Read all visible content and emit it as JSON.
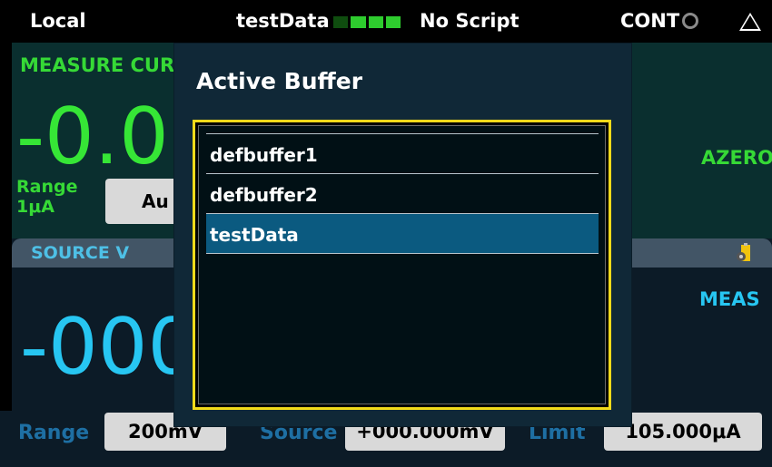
{
  "status_bar": {
    "mode": "Local",
    "buffer_name": "testData",
    "script": "No Script",
    "trigger": "CONT"
  },
  "measure": {
    "title": "MEASURE CUR",
    "value": "-0.0",
    "azero": "AZERO",
    "range_label": "Range",
    "range_value": "1μA",
    "range_button": "Au"
  },
  "source": {
    "title": "SOURCE V",
    "value": "-000",
    "meas_label": "MEAS"
  },
  "bottom_bar": {
    "range_label": "Range",
    "range_value": "200mV",
    "source_label": "Source",
    "source_value": "+000.000mV",
    "limit_label": "Limit",
    "limit_value": "105.000μA"
  },
  "dialog": {
    "title": "Active Buffer",
    "items": [
      {
        "label": "defbuffer1",
        "selected": false
      },
      {
        "label": "defbuffer2",
        "selected": false
      },
      {
        "label": "testData",
        "selected": true
      }
    ]
  },
  "icons": {
    "status": "cont-sync-icon",
    "warning": "warning-triangle-icon",
    "settings": "settings-icon"
  },
  "colors": {
    "measure_green": "#36d936",
    "source_blue": "#27c6f2",
    "selection": "#0b5a80",
    "focus_border": "#f2da1a"
  }
}
